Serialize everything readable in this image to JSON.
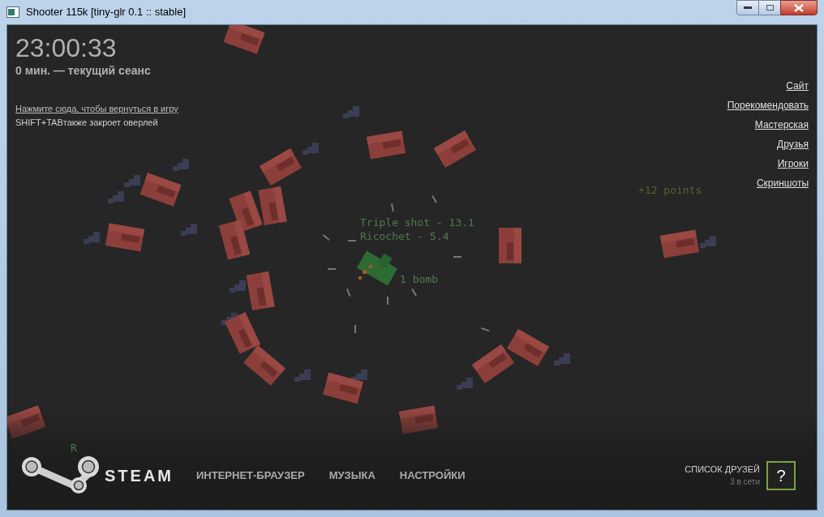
{
  "window": {
    "title": "Shooter 115k [tiny-glr 0.1 :: stable]"
  },
  "game": {
    "texts": [
      {
        "text": "+12 points",
        "kind": "bonus"
      },
      {
        "text": "Triple shot - 13.1",
        "kind": "powerup"
      },
      {
        "text": "Ricochet - 5.4",
        "kind": "powerup"
      },
      {
        "text": "1 bomb",
        "kind": "powerup"
      },
      {
        "text": "R",
        "kind": "powerup"
      }
    ]
  },
  "overlay": {
    "clock": "23:00:33",
    "session": "0 мин. — текущий сеанс",
    "return_link": "Нажмите сюда, чтобы вернуться в игру",
    "hint": "SHIFT+TABтакже закроет оверлей",
    "links": [
      "Сайт",
      "Порекомендовать",
      "Мастерская",
      "Друзья",
      "Игроки",
      "Скриншоты"
    ],
    "brand": "STEAM",
    "nav": [
      "ИНТЕРНЕТ-БРАУЗЕР",
      "МУЗЫКА",
      "НАСТРОЙКИ"
    ],
    "friends": {
      "title": "СПИСОК ДРУЗЕЙ",
      "online": "3 в сети",
      "help": "?"
    }
  }
}
